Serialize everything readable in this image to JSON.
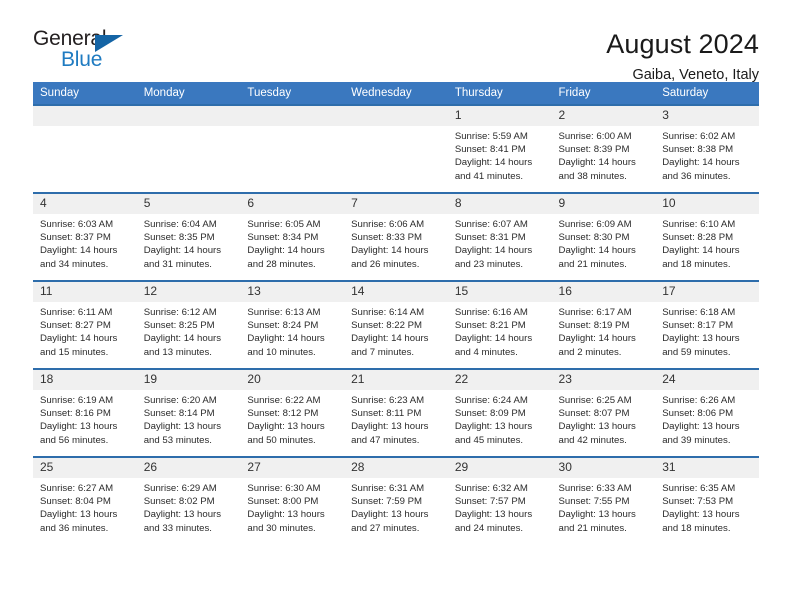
{
  "logo": {
    "word_top": "General",
    "word_bottom": "Blue",
    "triangle_icon": "triangle-icon",
    "accent_color": "#1464a5",
    "blue_color": "#1f7bc1"
  },
  "header": {
    "title": "August 2024",
    "subtitle": "Gaiba, Veneto, Italy",
    "header_bg_color": "#3a78bf",
    "daynum_bg_color": "#f0f0f0"
  },
  "weekdays": [
    "Sunday",
    "Monday",
    "Tuesday",
    "Wednesday",
    "Thursday",
    "Friday",
    "Saturday"
  ],
  "calendar": {
    "month": "August",
    "year": "2024",
    "location": "Gaiba, Veneto, Italy",
    "weeks": [
      [
        {
          "day": "",
          "empty": true
        },
        {
          "day": "",
          "empty": true
        },
        {
          "day": "",
          "empty": true
        },
        {
          "day": "",
          "empty": true
        },
        {
          "day": "1",
          "sunrise": "Sunrise: 5:59 AM",
          "sunset": "Sunset: 8:41 PM",
          "daylight_line1": "Daylight: 14 hours",
          "daylight_line2": "and 41 minutes."
        },
        {
          "day": "2",
          "sunrise": "Sunrise: 6:00 AM",
          "sunset": "Sunset: 8:39 PM",
          "daylight_line1": "Daylight: 14 hours",
          "daylight_line2": "and 38 minutes."
        },
        {
          "day": "3",
          "sunrise": "Sunrise: 6:02 AM",
          "sunset": "Sunset: 8:38 PM",
          "daylight_line1": "Daylight: 14 hours",
          "daylight_line2": "and 36 minutes."
        }
      ],
      [
        {
          "day": "4",
          "sunrise": "Sunrise: 6:03 AM",
          "sunset": "Sunset: 8:37 PM",
          "daylight_line1": "Daylight: 14 hours",
          "daylight_line2": "and 34 minutes."
        },
        {
          "day": "5",
          "sunrise": "Sunrise: 6:04 AM",
          "sunset": "Sunset: 8:35 PM",
          "daylight_line1": "Daylight: 14 hours",
          "daylight_line2": "and 31 minutes."
        },
        {
          "day": "6",
          "sunrise": "Sunrise: 6:05 AM",
          "sunset": "Sunset: 8:34 PM",
          "daylight_line1": "Daylight: 14 hours",
          "daylight_line2": "and 28 minutes."
        },
        {
          "day": "7",
          "sunrise": "Sunrise: 6:06 AM",
          "sunset": "Sunset: 8:33 PM",
          "daylight_line1": "Daylight: 14 hours",
          "daylight_line2": "and 26 minutes."
        },
        {
          "day": "8",
          "sunrise": "Sunrise: 6:07 AM",
          "sunset": "Sunset: 8:31 PM",
          "daylight_line1": "Daylight: 14 hours",
          "daylight_line2": "and 23 minutes."
        },
        {
          "day": "9",
          "sunrise": "Sunrise: 6:09 AM",
          "sunset": "Sunset: 8:30 PM",
          "daylight_line1": "Daylight: 14 hours",
          "daylight_line2": "and 21 minutes."
        },
        {
          "day": "10",
          "sunrise": "Sunrise: 6:10 AM",
          "sunset": "Sunset: 8:28 PM",
          "daylight_line1": "Daylight: 14 hours",
          "daylight_line2": "and 18 minutes."
        }
      ],
      [
        {
          "day": "11",
          "sunrise": "Sunrise: 6:11 AM",
          "sunset": "Sunset: 8:27 PM",
          "daylight_line1": "Daylight: 14 hours",
          "daylight_line2": "and 15 minutes."
        },
        {
          "day": "12",
          "sunrise": "Sunrise: 6:12 AM",
          "sunset": "Sunset: 8:25 PM",
          "daylight_line1": "Daylight: 14 hours",
          "daylight_line2": "and 13 minutes."
        },
        {
          "day": "13",
          "sunrise": "Sunrise: 6:13 AM",
          "sunset": "Sunset: 8:24 PM",
          "daylight_line1": "Daylight: 14 hours",
          "daylight_line2": "and 10 minutes."
        },
        {
          "day": "14",
          "sunrise": "Sunrise: 6:14 AM",
          "sunset": "Sunset: 8:22 PM",
          "daylight_line1": "Daylight: 14 hours",
          "daylight_line2": "and 7 minutes."
        },
        {
          "day": "15",
          "sunrise": "Sunrise: 6:16 AM",
          "sunset": "Sunset: 8:21 PM",
          "daylight_line1": "Daylight: 14 hours",
          "daylight_line2": "and 4 minutes."
        },
        {
          "day": "16",
          "sunrise": "Sunrise: 6:17 AM",
          "sunset": "Sunset: 8:19 PM",
          "daylight_line1": "Daylight: 14 hours",
          "daylight_line2": "and 2 minutes."
        },
        {
          "day": "17",
          "sunrise": "Sunrise: 6:18 AM",
          "sunset": "Sunset: 8:17 PM",
          "daylight_line1": "Daylight: 13 hours",
          "daylight_line2": "and 59 minutes."
        }
      ],
      [
        {
          "day": "18",
          "sunrise": "Sunrise: 6:19 AM",
          "sunset": "Sunset: 8:16 PM",
          "daylight_line1": "Daylight: 13 hours",
          "daylight_line2": "and 56 minutes."
        },
        {
          "day": "19",
          "sunrise": "Sunrise: 6:20 AM",
          "sunset": "Sunset: 8:14 PM",
          "daylight_line1": "Daylight: 13 hours",
          "daylight_line2": "and 53 minutes."
        },
        {
          "day": "20",
          "sunrise": "Sunrise: 6:22 AM",
          "sunset": "Sunset: 8:12 PM",
          "daylight_line1": "Daylight: 13 hours",
          "daylight_line2": "and 50 minutes."
        },
        {
          "day": "21",
          "sunrise": "Sunrise: 6:23 AM",
          "sunset": "Sunset: 8:11 PM",
          "daylight_line1": "Daylight: 13 hours",
          "daylight_line2": "and 47 minutes."
        },
        {
          "day": "22",
          "sunrise": "Sunrise: 6:24 AM",
          "sunset": "Sunset: 8:09 PM",
          "daylight_line1": "Daylight: 13 hours",
          "daylight_line2": "and 45 minutes."
        },
        {
          "day": "23",
          "sunrise": "Sunrise: 6:25 AM",
          "sunset": "Sunset: 8:07 PM",
          "daylight_line1": "Daylight: 13 hours",
          "daylight_line2": "and 42 minutes."
        },
        {
          "day": "24",
          "sunrise": "Sunrise: 6:26 AM",
          "sunset": "Sunset: 8:06 PM",
          "daylight_line1": "Daylight: 13 hours",
          "daylight_line2": "and 39 minutes."
        }
      ],
      [
        {
          "day": "25",
          "sunrise": "Sunrise: 6:27 AM",
          "sunset": "Sunset: 8:04 PM",
          "daylight_line1": "Daylight: 13 hours",
          "daylight_line2": "and 36 minutes."
        },
        {
          "day": "26",
          "sunrise": "Sunrise: 6:29 AM",
          "sunset": "Sunset: 8:02 PM",
          "daylight_line1": "Daylight: 13 hours",
          "daylight_line2": "and 33 minutes."
        },
        {
          "day": "27",
          "sunrise": "Sunrise: 6:30 AM",
          "sunset": "Sunset: 8:00 PM",
          "daylight_line1": "Daylight: 13 hours",
          "daylight_line2": "and 30 minutes."
        },
        {
          "day": "28",
          "sunrise": "Sunrise: 6:31 AM",
          "sunset": "Sunset: 7:59 PM",
          "daylight_line1": "Daylight: 13 hours",
          "daylight_line2": "and 27 minutes."
        },
        {
          "day": "29",
          "sunrise": "Sunrise: 6:32 AM",
          "sunset": "Sunset: 7:57 PM",
          "daylight_line1": "Daylight: 13 hours",
          "daylight_line2": "and 24 minutes."
        },
        {
          "day": "30",
          "sunrise": "Sunrise: 6:33 AM",
          "sunset": "Sunset: 7:55 PM",
          "daylight_line1": "Daylight: 13 hours",
          "daylight_line2": "and 21 minutes."
        },
        {
          "day": "31",
          "sunrise": "Sunrise: 6:35 AM",
          "sunset": "Sunset: 7:53 PM",
          "daylight_line1": "Daylight: 13 hours",
          "daylight_line2": "and 18 minutes."
        }
      ]
    ]
  }
}
